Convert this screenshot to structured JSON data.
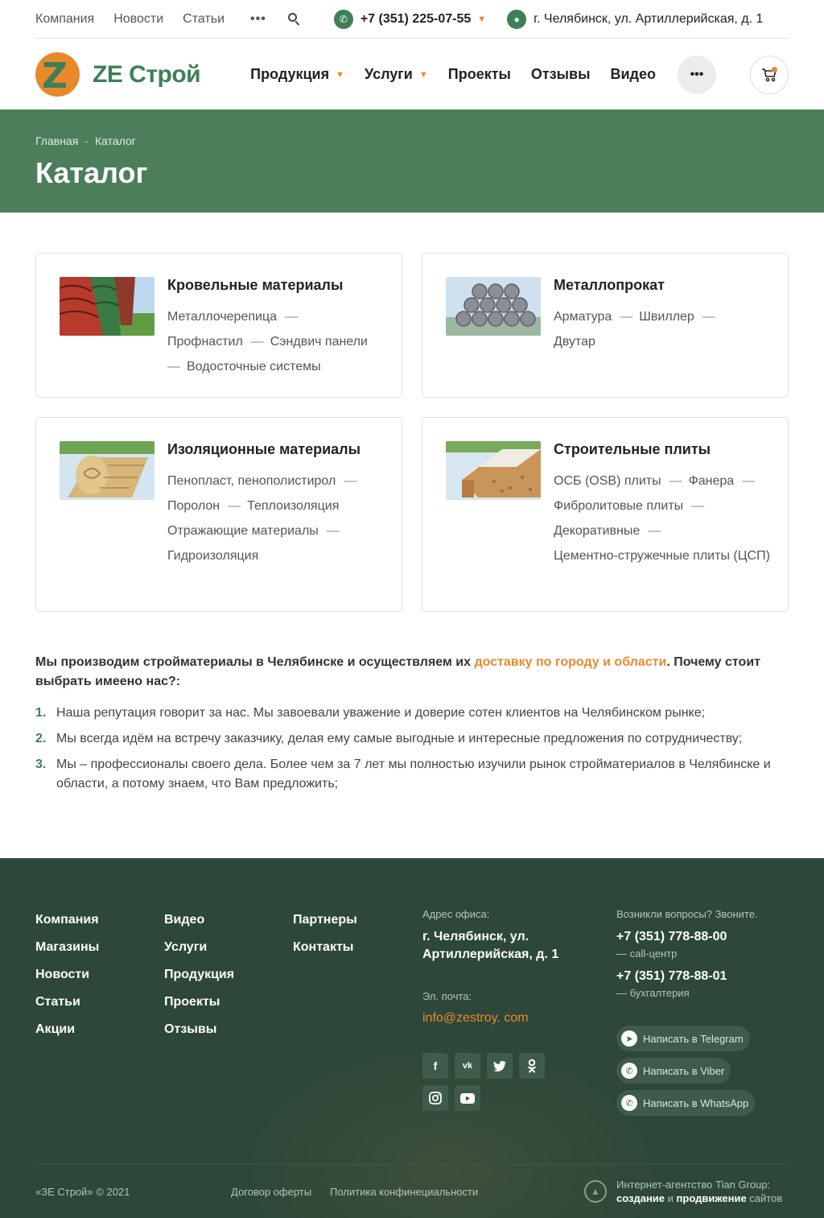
{
  "top": {
    "links": [
      "Компания",
      "Новости",
      "Статьи"
    ],
    "more": "•••",
    "phone": "+7 (351) 225-07-55",
    "address": "г. Челябинск, ул. Артиллерийская, д. 1"
  },
  "header": {
    "logo_letter": "Z",
    "logo_text": "ZE Строй",
    "nav": [
      {
        "label": "Продукция",
        "dropdown": true
      },
      {
        "label": "Услуги",
        "dropdown": true
      },
      {
        "label": "Проекты"
      },
      {
        "label": "Отзывы"
      },
      {
        "label": "Видео"
      }
    ],
    "more": "•••"
  },
  "banner": {
    "breadcrumb": [
      "Главная",
      "Каталог"
    ],
    "breadcrumb_sep": "-",
    "title": "Каталог"
  },
  "catalog": [
    {
      "title": "Кровельные материалы",
      "image": "roof-tiles-image",
      "links": [
        "Металлочерепица",
        "Профнастил",
        "Сэндвич панели",
        "Водосточные системы"
      ]
    },
    {
      "title": "Металлопрокат",
      "image": "metal-rods-image",
      "links": [
        "Арматура",
        "Швиллер",
        "Двутар"
      ]
    },
    {
      "title": "Изоляционные материалы",
      "image": "insulation-rolls-image",
      "links": [
        "Пенопласт, пенополистирол",
        "Поролон",
        "Теплоизоляция",
        "Отражающие материалы",
        "Гидроизоляция"
      ]
    },
    {
      "title": "Строительные плиты",
      "image": "osb-boards-image",
      "links": [
        "ОСБ (OSB) плиты",
        "Фанера",
        "Фибролитовые плиты",
        "Декоративные",
        "Цементно-стружечные плиты (ЦСП)"
      ]
    }
  ],
  "about": {
    "intro_start": "Мы производим стройматериалы в Челябинске и осуществляем их ",
    "intro_link": "доставку по городу и области",
    "intro_end": ". Почему стоит выбрать имеено нас?:",
    "points": [
      "Наша репутация говорит за нас. Мы завоевали уважение и доверие сотен клиентов на Челябинском рынке;",
      "Мы всегда идём на встречу заказчику, делая ему самые выгодные и интересные предложения по сотрудничеству;",
      "Мы – профессионалы своего дела. Более чем за 7 лет мы полностью изучили рынок стройматериалов в Челябинске и области, а потому знаем, что Вам предложить;"
    ]
  },
  "footer": {
    "col1": [
      "Компания",
      "Магазины",
      "Новости",
      "Статьи",
      "Акции"
    ],
    "col2": [
      "Видео",
      "Услуги",
      "Продукция",
      "Проекты",
      "Отзывы"
    ],
    "col3": [
      "Партнеры",
      "Контакты"
    ],
    "address_label": "Адрес офиса:",
    "address": "г. Челябинск, ул. Артиллерийская, д. 1",
    "email_label": "Эл. почта:",
    "email": "info@zestroy. com",
    "social": [
      "f",
      "vk",
      "tw",
      "ok",
      "ig",
      "yt"
    ],
    "questions_label": "Возникли вопросы? Звоните.",
    "phone1": "+7 (351) 778-88-00",
    "phone1_note": "— call-центр",
    "phone2": "+7 (351) 778-88-01",
    "phone2_note": "— бухгалтерия",
    "messengers": [
      "Написать в Telegram",
      "Написать в Viber",
      "Написать в WhatsApp"
    ],
    "copyright": "«ЗЕ Строй» © 2021",
    "offer": "Договор оферты",
    "privacy": "Политика конфинециальности",
    "agency_line1": "Интернет-агентство Tian Group:",
    "agency_b1": "создание",
    "agency_mid": " и ",
    "agency_b2": "продвижение",
    "agency_end": " сайтов"
  }
}
